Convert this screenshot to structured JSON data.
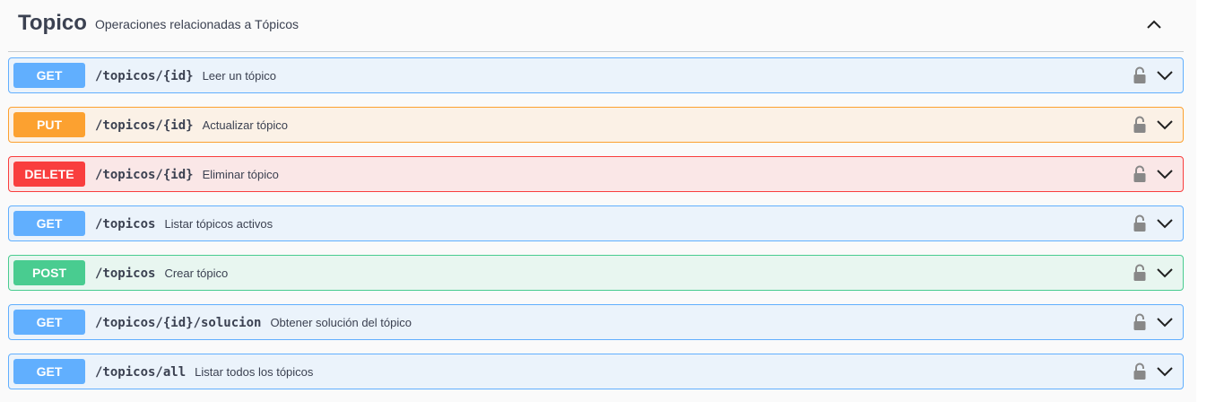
{
  "tag": {
    "name": "Topico",
    "description": "Operaciones relacionadas a Tópicos",
    "toggle_icon": "chevron-up-icon"
  },
  "operations": [
    {
      "method": "GET",
      "path": "/topicos/{id}",
      "summary": "Leer un tópico",
      "color": "#61affe",
      "bg": "#ebf3fb"
    },
    {
      "method": "PUT",
      "path": "/topicos/{id}",
      "summary": "Actualizar tópico",
      "color": "#fca130",
      "bg": "#fbf1e6"
    },
    {
      "method": "DELETE",
      "path": "/topicos/{id}",
      "summary": "Eliminar tópico",
      "color": "#f93e3e",
      "bg": "#fae7e7"
    },
    {
      "method": "GET",
      "path": "/topicos",
      "summary": "Listar tópicos activos",
      "color": "#61affe",
      "bg": "#ebf3fb"
    },
    {
      "method": "POST",
      "path": "/topicos",
      "summary": "Crear tópico",
      "color": "#49cc90",
      "bg": "#e8f6f0"
    },
    {
      "method": "GET",
      "path": "/topicos/{id}/solucion",
      "summary": "Obtener solución del tópico",
      "color": "#61affe",
      "bg": "#ebf3fb"
    },
    {
      "method": "GET",
      "path": "/topicos/all",
      "summary": "Listar todos los tópicos",
      "color": "#61affe",
      "bg": "#ebf3fb"
    }
  ],
  "icons": {
    "lock": "lock-icon",
    "expand": "chevron-down-icon"
  }
}
